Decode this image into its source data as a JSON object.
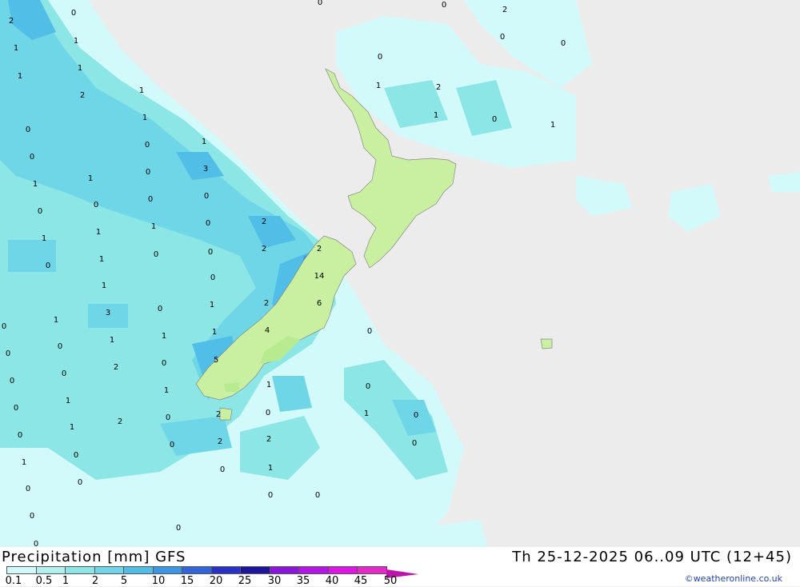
{
  "map": {
    "title": "Precipitation [mm] GFS",
    "valid_time": "Th 25-12-2025 06..09 UTC (12+45)",
    "credit": "©weatheronline.co.uk",
    "grid_values": [
      "0",
      "2",
      "1",
      "1",
      "1",
      "1",
      "2",
      "1",
      "1",
      "0",
      "0",
      "0",
      "0",
      "1",
      "1",
      "1",
      "3",
      "0",
      "0",
      "0",
      "0",
      "1",
      "1",
      "0",
      "2",
      "2",
      "1",
      "0",
      "0",
      "0",
      "1",
      "0",
      "14",
      "6",
      "2",
      "2",
      "1",
      "1",
      "1",
      "3",
      "0",
      "1",
      "0",
      "1",
      "4",
      "1",
      "0",
      "0",
      "0",
      "5",
      "0",
      "2",
      "0",
      "1",
      "1",
      "2",
      "1",
      "0",
      "2",
      "0",
      "1",
      "2",
      "2",
      "1",
      "0",
      "0",
      "0",
      "0",
      "0",
      "1",
      "0",
      "0",
      "0",
      "0",
      "0",
      "0",
      "0",
      "0",
      "0",
      "0",
      "1",
      "0",
      "0",
      "0",
      "1",
      "2",
      "1",
      "0",
      "2",
      "0",
      "0",
      "0",
      "1"
    ],
    "legend": {
      "labels": [
        "0.1",
        "0.5",
        "1",
        "2",
        "5",
        "10",
        "15",
        "20",
        "25",
        "30",
        "35",
        "40",
        "45",
        "50"
      ],
      "colors": [
        "#d3fafa",
        "#b4f0f0",
        "#8ce6e6",
        "#6ed6e6",
        "#50bee6",
        "#3c96e6",
        "#3264dc",
        "#2832c8",
        "#1e14a0",
        "#8c14dc",
        "#b414e6",
        "#dc14e6",
        "#e628c8",
        "#be14aa"
      ]
    }
  }
}
